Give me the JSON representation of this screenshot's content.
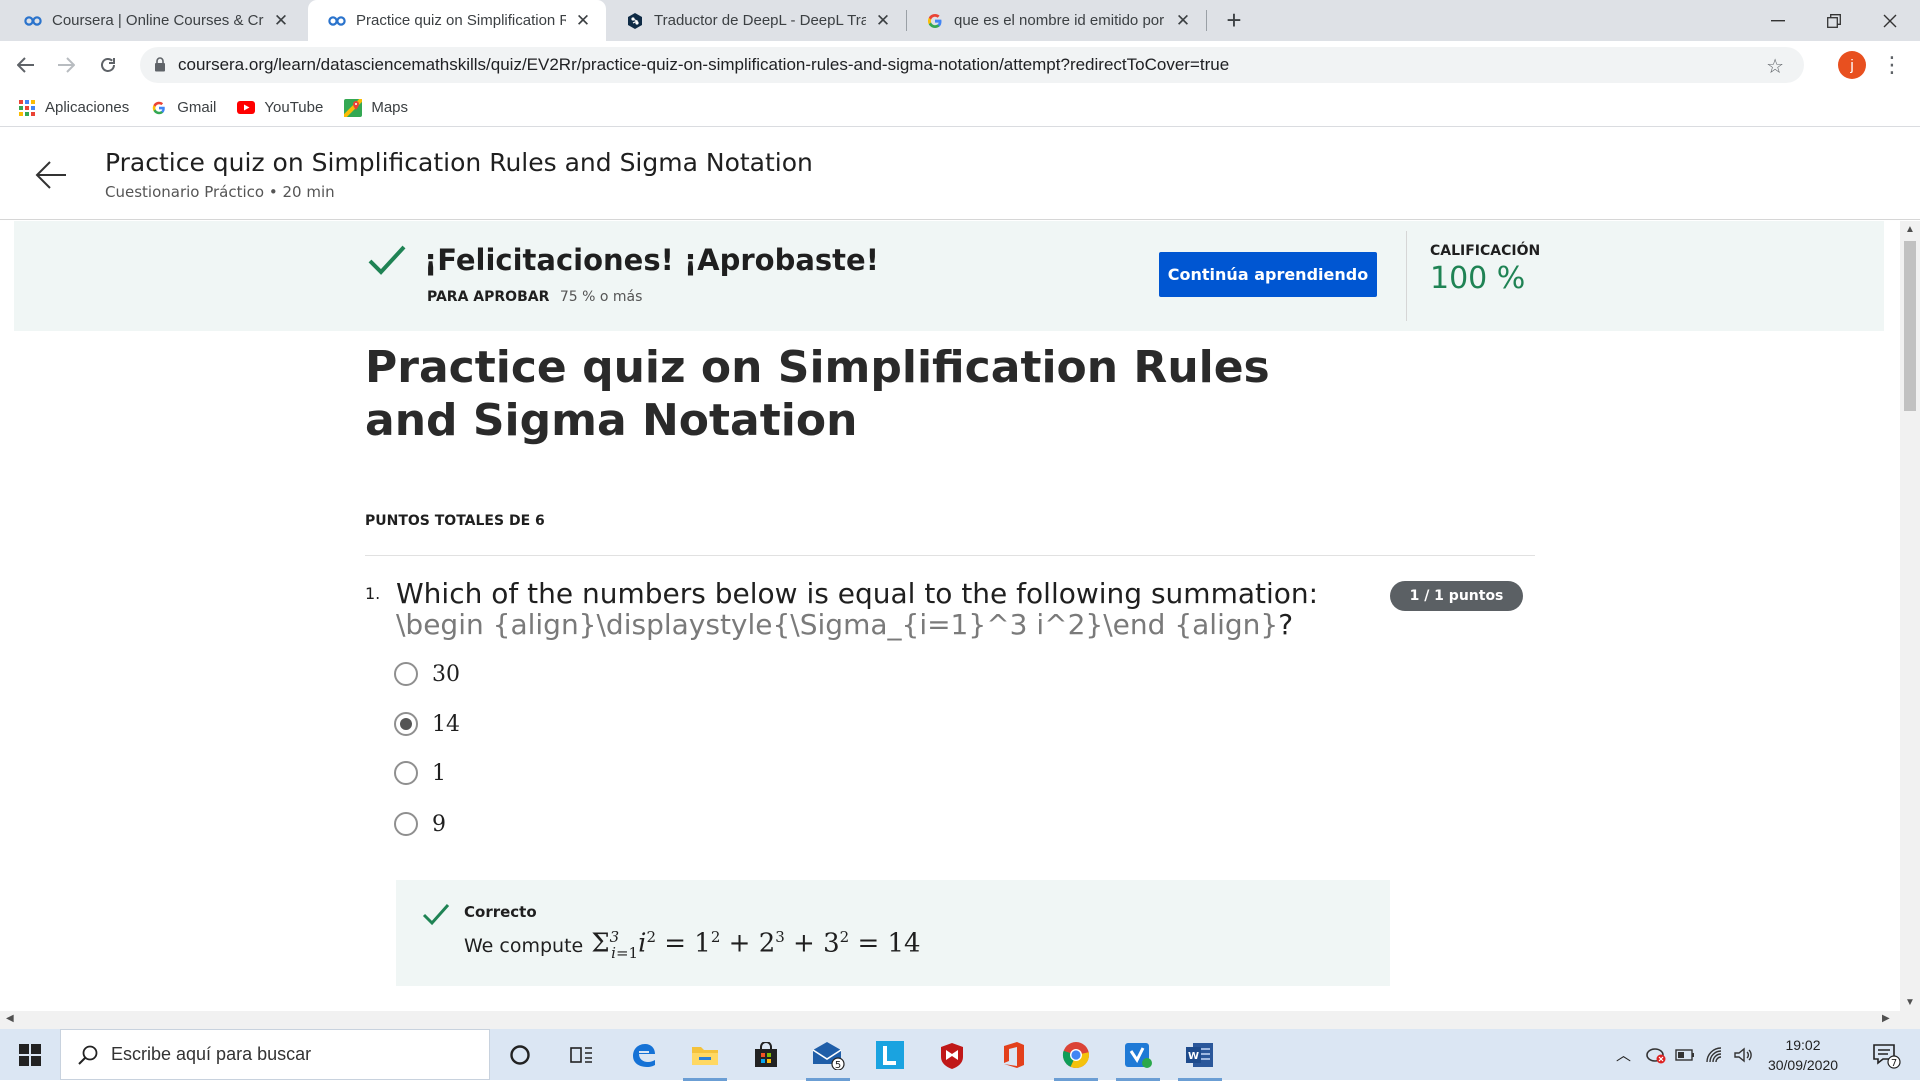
{
  "browser": {
    "tabs": [
      {
        "title": "Coursera | Online Courses & Credentials",
        "icon": "coursera-icon",
        "active": false
      },
      {
        "title": "Practice quiz on Simplification Rules and Sigma Notation",
        "icon": "coursera-icon",
        "active": true
      },
      {
        "title": "Traductor de DeepL - DeepL Translate",
        "icon": "deepl-icon",
        "active": false
      },
      {
        "title": "que es el nombre id emitido por",
        "icon": "google-icon",
        "active": false
      }
    ],
    "new_tab": "+",
    "url": "coursera.org/learn/datasciencemathskills/quiz/EV2Rr/practice-quiz-on-simplification-rules-and-sigma-notation/attempt?redirectToCover=true",
    "profile_initial": "j",
    "bookmarks": [
      "Aplicaciones",
      "Gmail",
      "YouTube",
      "Maps"
    ]
  },
  "header": {
    "title": "Practice quiz on Simplification Rules and Sigma Notation",
    "subtitle": "Cuestionario Práctico • 20 min"
  },
  "banner": {
    "message": "¡Felicitaciones! ¡Aprobaste!",
    "pass_label": "PARA APROBAR",
    "pass_value": "75 % o más",
    "button": "Continúa aprendiendo",
    "grade_label": "CALIFICACIÓN",
    "grade_value": "100 %"
  },
  "quiz": {
    "title": "Practice quiz on Simplification Rules and Sigma Notation",
    "total_points": "PUNTOS TOTALES DE 6",
    "question": {
      "number": "1.",
      "text": "Which of the numbers below is equal to the following summation: ",
      "tex": "\\begin {align}\\displaystyle{\\Sigma_{i=1}^3 i^2}\\end {align}",
      "tail": "?",
      "points": "1 / 1 puntos",
      "options": [
        "30",
        "14",
        "1",
        "9"
      ],
      "selected_index": 1,
      "feedback_label": "Correcto",
      "feedback_text": "We compute"
    }
  },
  "taskbar": {
    "search_placeholder": "Escribe aquí para buscar",
    "time": "19:02",
    "date": "30/09/2020",
    "mail_badge": "5",
    "notif_badge": "7"
  },
  "colors": {
    "accent": "#0056d2",
    "success": "#1f8354",
    "banner_bg": "#f0f6f5"
  }
}
